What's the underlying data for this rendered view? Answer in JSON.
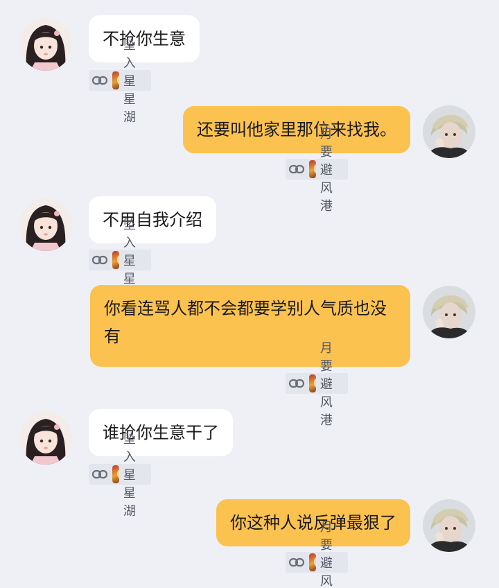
{
  "chat": {
    "users": {
      "left": {
        "name": "坠入星星湖",
        "avatar_icon": "anime-girl-avatar-icon"
      },
      "right": {
        "name": "月要避风港",
        "avatar_icon": "boy-avatar-icon"
      }
    },
    "messages": [
      {
        "side": "left",
        "text": "不抢你生意",
        "sender": "坠入星星湖"
      },
      {
        "side": "right",
        "text": "还要叫他家里那位来找我。",
        "sender": "月要避风港"
      },
      {
        "side": "left",
        "text": "不用自我介绍",
        "sender": "坠入星星湖"
      },
      {
        "side": "right",
        "text": "你看连骂人都不会都要学别人气质也没有",
        "sender": "月要避风港"
      },
      {
        "side": "left",
        "text": "谁抢你生意干了",
        "sender": "坠入星星湖"
      },
      {
        "side": "right",
        "text": "你这种人说反弹最狠了",
        "sender": "月要避风港"
      }
    ]
  },
  "colors": {
    "background": "#eef0f6",
    "incoming_bubble": "#ffffff",
    "outgoing_bubble": "#fcc250",
    "meta_tag": "#e4e6ed"
  }
}
